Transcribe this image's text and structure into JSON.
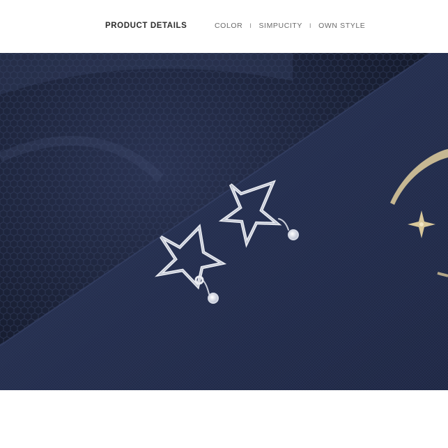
{
  "header": {
    "title": "PRODUCT DETAILS",
    "tags": [
      "COLOR",
      "SIMPUCITY",
      "OWN STYLE"
    ],
    "separator": "I"
  },
  "photo": {
    "subject": "star-stud-earrings",
    "colors": {
      "mesh": "#1e2740",
      "paper": "#26304f",
      "silver": "#e8eaf0",
      "gold": "#d8c79a"
    }
  }
}
